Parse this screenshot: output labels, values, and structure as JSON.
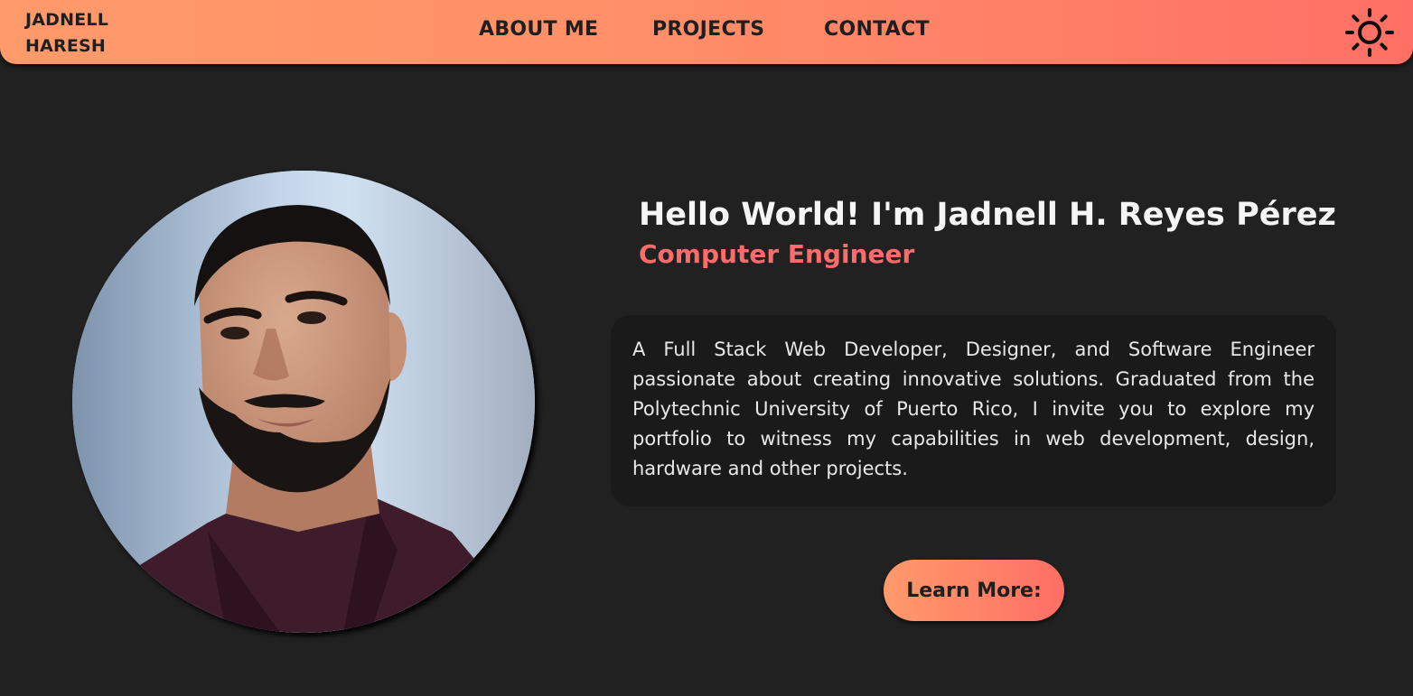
{
  "navbar": {
    "brand_line1": "JADNELL",
    "brand_line2": "HARESH",
    "links": [
      {
        "label": "ABOUT ME"
      },
      {
        "label": "PROJECTS"
      },
      {
        "label": "CONTACT"
      }
    ],
    "theme_toggle_icon": "sun-icon"
  },
  "hero": {
    "greeting": "Hello World! I'm Jadnell H. Reyes Pérez",
    "role": "Computer Engineer",
    "bio": "A Full Stack Web Developer, Designer, and Software Engineer passionate about creating innovative solutions. Graduated from the Polytechnic University of Puerto Rico, I invite you to explore my portfolio to witness my capabilities in web development, design, hardware and other projects.",
    "cta_label": "Learn More:"
  },
  "colors": {
    "background": "#212121",
    "accent_start": "#ff9a6a",
    "accent_end": "#ff6e65",
    "role_color": "#ff6b6b",
    "card_bg": "#1a1a1a"
  }
}
